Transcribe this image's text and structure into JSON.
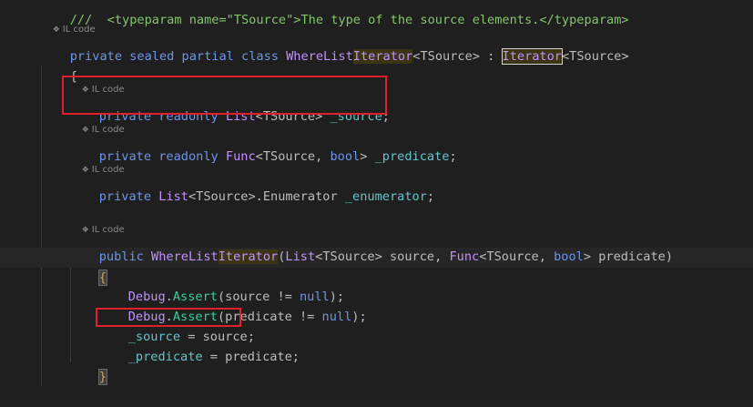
{
  "hint_label": "IL code",
  "top_comment": "///  <typeparam name=\"TSource\">The type of the source elements.</typeparam>",
  "class_decl": {
    "mod1": "private",
    "mod2": "sealed",
    "mod3": "partial",
    "kw_class": "class",
    "name_pre": "WhereList",
    "name_hl": "Iterator",
    "generic": "<TSource>",
    "colon": " : ",
    "base": "Iterator",
    "base_generic": "<TSource>"
  },
  "open_brace": "{",
  "fields": [
    {
      "mods": "private readonly",
      "type": "List",
      "generic": "<TSource>",
      "name": "_source",
      "end": ";"
    },
    {
      "mods": "private readonly",
      "type": "Func",
      "generic": "<TSource, ",
      "kw2": "bool",
      "generic_end": ">",
      "name": "_predicate",
      "end": ";"
    },
    {
      "mods": "private",
      "type": "List",
      "generic": "<TSource>.Enumerator",
      "name": "_enumerator",
      "end": ";"
    }
  ],
  "ctor": {
    "mod": "public",
    "name_pre": "WhereList",
    "name_hl": "Iterator",
    "p_open": "(",
    "p1_type": "List",
    "p1_generic": "<TSource>",
    "p1_name": " source, ",
    "p2_type": "Func",
    "p2_generic": "<TSource, ",
    "p2_kw": "bool",
    "p2_end": "> predicate)"
  },
  "body_open": "{",
  "body": [
    {
      "obj": "Debug",
      "dot": ".",
      "method": "Assert",
      "args_a": "(source != ",
      "kw": "null",
      "args_b": ");"
    },
    {
      "obj": "Debug",
      "dot": ".",
      "method": "Assert",
      "args_a": "(predicate != ",
      "kw": "null",
      "args_b": ");"
    },
    {
      "field": "_source",
      "rest": " = source;"
    },
    {
      "field": "_predicate",
      "rest": " = predicate;"
    }
  ],
  "body_close": "}"
}
